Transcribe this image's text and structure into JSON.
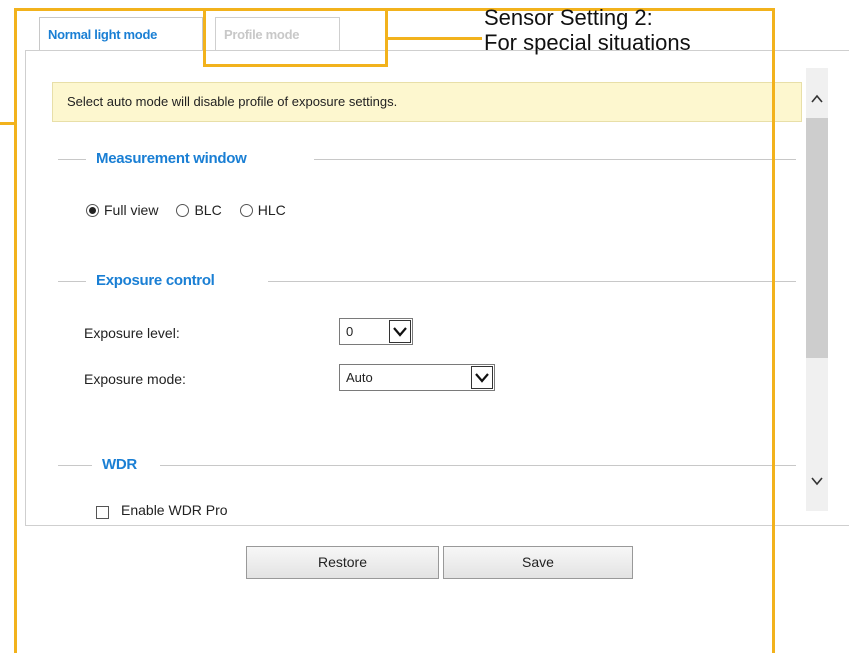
{
  "tabs": {
    "normal": "Normal light mode",
    "profile": "Profile mode"
  },
  "notice": "Select auto mode will disable profile of exposure settings.",
  "measurement": {
    "title": "Measurement window",
    "options": [
      "Full view",
      "BLC",
      "HLC"
    ],
    "selected": "Full view"
  },
  "exposure": {
    "title": "Exposure control",
    "level_label": "Exposure level:",
    "level_value": "0",
    "mode_label": "Exposure mode:",
    "mode_value": "Auto"
  },
  "wdr": {
    "title": "WDR",
    "enable_label": "Enable WDR Pro"
  },
  "buttons": {
    "restore": "Restore",
    "save": "Save"
  },
  "annotation": {
    "line1": "Sensor Setting 2:",
    "line2": "For special situations"
  },
  "colors": {
    "accent": "#1a7fd4",
    "annotation": "#f2b21c",
    "notice_bg": "#fdf7cf"
  }
}
